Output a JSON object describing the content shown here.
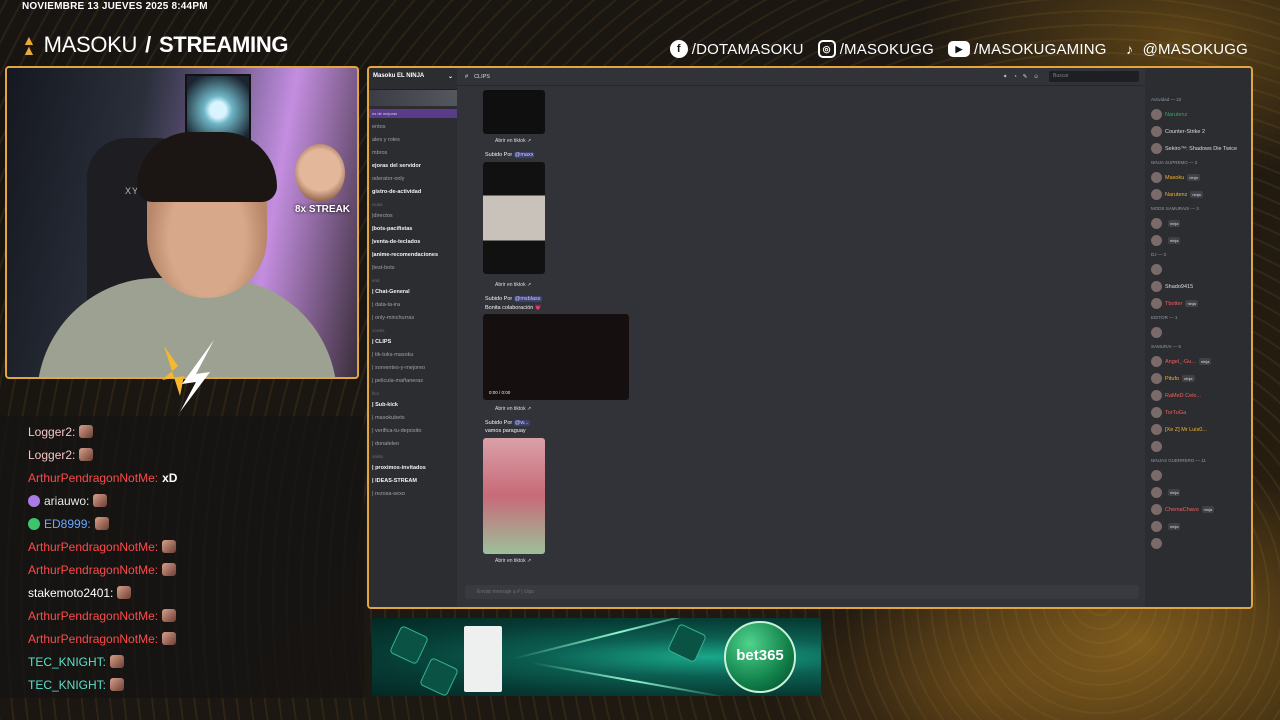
{
  "overlay": {
    "date_line": "NOVIEMBRE 13 JUEVES 2025 8:44PM",
    "brand_name": "MASOKU",
    "brand_sep": "/",
    "brand_section": "STREAMING",
    "accent_color": "#e3a53d"
  },
  "socials": [
    {
      "icon": "facebook-icon",
      "glyph": "f",
      "handle": "/DOTAMASOKU"
    },
    {
      "icon": "instagram-icon",
      "glyph": "◎",
      "handle": "/MASOKUGG"
    },
    {
      "icon": "youtube-icon",
      "glyph": "▶",
      "handle": "/MASOKUGAMING"
    },
    {
      "icon": "tiktok-icon",
      "glyph": "♪",
      "handle": "@MASOKUGG"
    }
  ],
  "webcam": {
    "streak_label": "8x STREAK",
    "chair_brand": "XYRTX"
  },
  "chat": [
    {
      "user": "Logger2:",
      "color": "#f2c6c6",
      "msg": "",
      "emote": true,
      "badge": null
    },
    {
      "user": "Logger2:",
      "color": "#f2c6c6",
      "msg": "",
      "emote": true,
      "badge": null
    },
    {
      "user": "ArthurPendragonNotMe:",
      "color": "#ff4a4a",
      "msg": "xD",
      "emote": false,
      "badge": null
    },
    {
      "user": "ariauwo:",
      "color": "#e8e8e8",
      "msg": "",
      "emote": true,
      "badge": "#a97be6"
    },
    {
      "user": "ED8999:",
      "color": "#6aa7ff",
      "msg": "",
      "emote": true,
      "badge": "#3ec46d"
    },
    {
      "user": "ArthurPendragonNotMe:",
      "color": "#ff4a4a",
      "msg": "",
      "emote": true,
      "badge": null
    },
    {
      "user": "ArthurPendragonNotMe:",
      "color": "#ff4a4a",
      "msg": "",
      "emote": true,
      "badge": null
    },
    {
      "user": "stakemoto2401:",
      "color": "#ffffff",
      "msg": "",
      "emote": true,
      "badge": null
    },
    {
      "user": "ArthurPendragonNotMe:",
      "color": "#ff4a4a",
      "msg": "",
      "emote": true,
      "badge": null
    },
    {
      "user": "ArthurPendragonNotMe:",
      "color": "#ff4a4a",
      "msg": "",
      "emote": true,
      "badge": null
    },
    {
      "user": "TEC_KNIGHT:",
      "color": "#5be0c8",
      "msg": "",
      "emote": true,
      "badge": null
    },
    {
      "user": "TEC_KNIGHT:",
      "color": "#5be0c8",
      "msg": "",
      "emote": true,
      "badge": null
    }
  ],
  "discord": {
    "server_name": "Masoku EL NINJA",
    "boost_text": "es de mejoras",
    "channel_header": "CLIPS",
    "search_placeholder": "Buscar",
    "input_placeholder": "Enviar mensaje a # | clips",
    "channels": [
      {
        "kind": "ch",
        "label": "entos"
      },
      {
        "kind": "ch",
        "label": "ales y roles"
      },
      {
        "kind": "ch",
        "label": "mbros"
      },
      {
        "kind": "ch",
        "label": "ejoras del servidor",
        "bold": true
      },
      {
        "kind": "ch",
        "label": "oderator-only"
      },
      {
        "kind": "ch",
        "label": "gistro-de-actividad",
        "bold": true
      },
      {
        "kind": "cat",
        "label": "ncias"
      },
      {
        "kind": "ch",
        "label": "|directos"
      },
      {
        "kind": "ch",
        "label": "|bots-pacifistas",
        "bold": true
      },
      {
        "kind": "ch",
        "label": "|venta-de-teclados",
        "bold": true
      },
      {
        "kind": "ch",
        "label": "|anime-recomendaciones",
        "bold": true
      },
      {
        "kind": "ch",
        "label": "|test-bots"
      },
      {
        "kind": "cat",
        "label": "eral"
      },
      {
        "kind": "ch",
        "label": "| Chat-General",
        "bold": true
      },
      {
        "kind": "ch",
        "label": "| data-ta-ira"
      },
      {
        "kind": "ch",
        "label": "| only-minchurras"
      },
      {
        "kind": "cat",
        "label": "ccesis"
      },
      {
        "kind": "ch",
        "label": "| CLIPS",
        "bold": true
      },
      {
        "kind": "ch",
        "label": "| tik-toks-masoku"
      },
      {
        "kind": "ch",
        "label": "| sorventes-y-mejoreo"
      },
      {
        "kind": "ch",
        "label": "| pelicula-mañaneras"
      },
      {
        "kind": "cat",
        "label": "fico"
      },
      {
        "kind": "ch",
        "label": "| Sub-kick",
        "bold": true
      },
      {
        "kind": "ch",
        "label": "| masokubets"
      },
      {
        "kind": "ch",
        "label": "| verifica-tu-deposito"
      },
      {
        "kind": "ch",
        "label": "| donateleo"
      },
      {
        "kind": "cat",
        "label": "onido"
      },
      {
        "kind": "ch",
        "label": "| proximos-invitados",
        "bold": true
      },
      {
        "kind": "ch",
        "label": "| IDEAS-STREAM",
        "bold": true
      },
      {
        "kind": "ch",
        "label": "| rezosa-sexo"
      }
    ],
    "messages": {
      "open_tiktok": "Abrir en tiktok",
      "uploaded_by": "Subido Por",
      "mention_1": "@maxx",
      "mention_2": "@msblass",
      "mention_3": "@w...",
      "caption_2": "Bonita colaboración 💗",
      "caption_3": "vamos paraguay",
      "video_time": "0:00 / 0:00"
    },
    "members": [
      {
        "kind": "cat",
        "label": "Actividad — 22"
      },
      {
        "kind": "m",
        "name": "Narutenz",
        "tag": "",
        "color": "#3ba55d"
      },
      {
        "kind": "m",
        "name": "Counter-Strike 2",
        "tag": "",
        "color": "#dbdee1"
      },
      {
        "kind": "m",
        "name": "Sekiro™: Shadows Die Twice",
        "tag": "",
        "color": "#dbdee1"
      },
      {
        "kind": "cat",
        "label": "NINJA SUPREMO — 2"
      },
      {
        "kind": "m",
        "name": "Masoku",
        "tag": "ninja",
        "color": "#f0b232"
      },
      {
        "kind": "m",
        "name": "Narutenz",
        "tag": "ninja",
        "color": "#f0b232"
      },
      {
        "kind": "cat",
        "label": "MODS SAMURAIS — 3"
      },
      {
        "kind": "m",
        "name": "",
        "tag": "ninja",
        "color": "#8fa6ff"
      },
      {
        "kind": "m",
        "name": "",
        "tag": "ninja",
        "color": "#ff5c5c"
      },
      {
        "kind": "cat",
        "label": "DJ — 3"
      },
      {
        "kind": "m",
        "name": "",
        "tag": "",
        "color": "#b57bff"
      },
      {
        "kind": "m",
        "name": "Shado9415",
        "tag": "",
        "color": "#dbdee1"
      },
      {
        "kind": "m",
        "name": "Tbotter",
        "tag": "ninja",
        "color": "#ff5c5c"
      },
      {
        "kind": "cat",
        "label": "EDITOR — 1"
      },
      {
        "kind": "m",
        "name": "",
        "tag": "",
        "color": "#ff5c5c"
      },
      {
        "kind": "cat",
        "label": "SAMURAI — 6"
      },
      {
        "kind": "m",
        "name": "Angel_-Gu...",
        "tag": "ninja",
        "color": "#ff5c5c"
      },
      {
        "kind": "m",
        "name": "Pitufo",
        "tag": "ninja",
        "color": "#f0b232"
      },
      {
        "kind": "m",
        "name": "RaMeD Celo...",
        "tag": "",
        "color": "#ff5c5c"
      },
      {
        "kind": "m",
        "name": "TorTuGa",
        "tag": "",
        "color": "#ff5c5c"
      },
      {
        "kind": "m",
        "name": "[Xe Z] Mr Luis0...",
        "tag": "",
        "color": "#f0b232"
      },
      {
        "kind": "m",
        "name": "",
        "tag": "",
        "color": "#6aa7ff"
      },
      {
        "kind": "cat",
        "label": "NINJAS GUERRERO — 11"
      },
      {
        "kind": "m",
        "name": "",
        "tag": "",
        "color": "#ff5c5c"
      },
      {
        "kind": "m",
        "name": "",
        "tag": "ninja",
        "color": "#ff5c5c"
      },
      {
        "kind": "m",
        "name": "ChemaChavo",
        "tag": "ninja",
        "color": "#ff5c5c"
      },
      {
        "kind": "m",
        "name": "",
        "tag": "ninja",
        "color": "#ff5c5c"
      },
      {
        "kind": "m",
        "name": "",
        "tag": "",
        "color": "#ff5c5c"
      }
    ]
  },
  "ad": {
    "logo": "bet365"
  }
}
